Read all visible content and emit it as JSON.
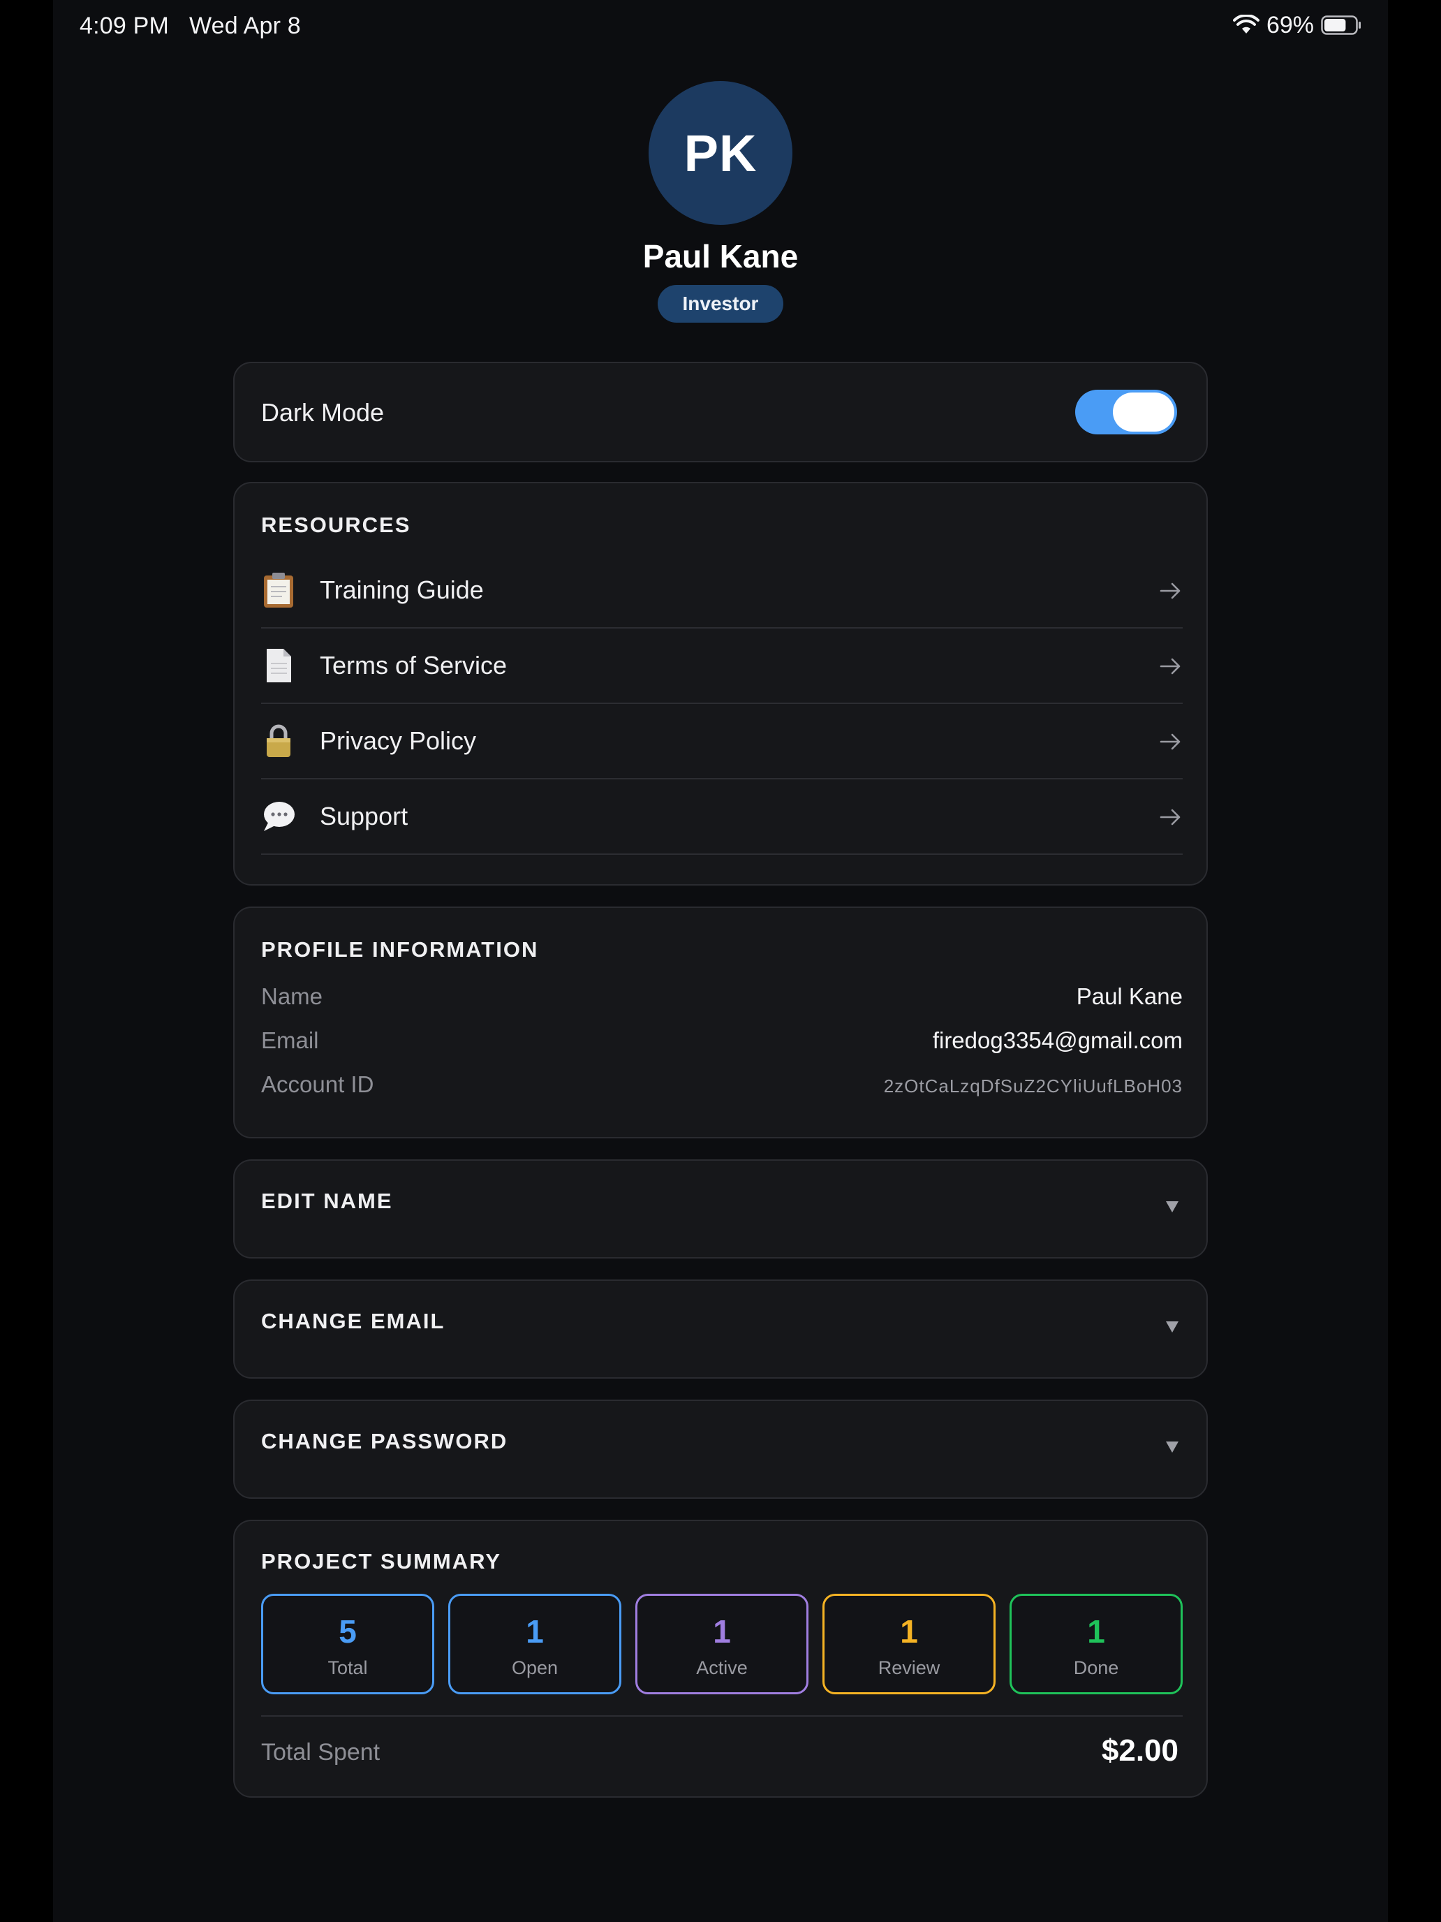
{
  "status_bar": {
    "time": "4:09 PM",
    "date": "Wed Apr 8",
    "battery_percent": "69%",
    "battery_level": 0.69,
    "icons": [
      "wifi-icon",
      "battery-icon"
    ]
  },
  "profile": {
    "initials": "PK",
    "name": "Paul Kane",
    "role": "Investor"
  },
  "settings": {
    "dark_mode_label": "Dark Mode",
    "dark_mode_on": true,
    "accent_color": "#4a9cf5"
  },
  "resources": {
    "title": "RESOURCES",
    "items": [
      {
        "label": "Training Guide",
        "icon": "clipboard-icon"
      },
      {
        "label": "Terms of Service",
        "icon": "document-icon"
      },
      {
        "label": "Privacy Policy",
        "icon": "lock-icon"
      },
      {
        "label": "Support",
        "icon": "speech-bubble-icon"
      }
    ]
  },
  "profile_info": {
    "title": "PROFILE INFORMATION",
    "rows": [
      {
        "label": "Name",
        "value": "Paul Kane"
      },
      {
        "label": "Email",
        "value": "firedog3354@gmail.com"
      },
      {
        "label": "Account ID",
        "value": "2zOtCaLzqDfSuZ2CYliUufLBoH03"
      }
    ]
  },
  "sections": {
    "edit_name": "EDIT NAME",
    "change_email": "CHANGE EMAIL",
    "change_password": "CHANGE PASSWORD"
  },
  "project_summary": {
    "title": "PROJECT SUMMARY",
    "stats": [
      {
        "value": "5",
        "label": "Total",
        "color": "#4a9cf5"
      },
      {
        "value": "1",
        "label": "Open",
        "color": "#4a9cf5"
      },
      {
        "value": "1",
        "label": "Active",
        "color": "#a07ee0"
      },
      {
        "value": "1",
        "label": "Review",
        "color": "#f5b324"
      },
      {
        "value": "1",
        "label": "Done",
        "color": "#1fc25a"
      }
    ],
    "total_spent_label": "Total Spent",
    "total_spent_value": "$2.00"
  }
}
